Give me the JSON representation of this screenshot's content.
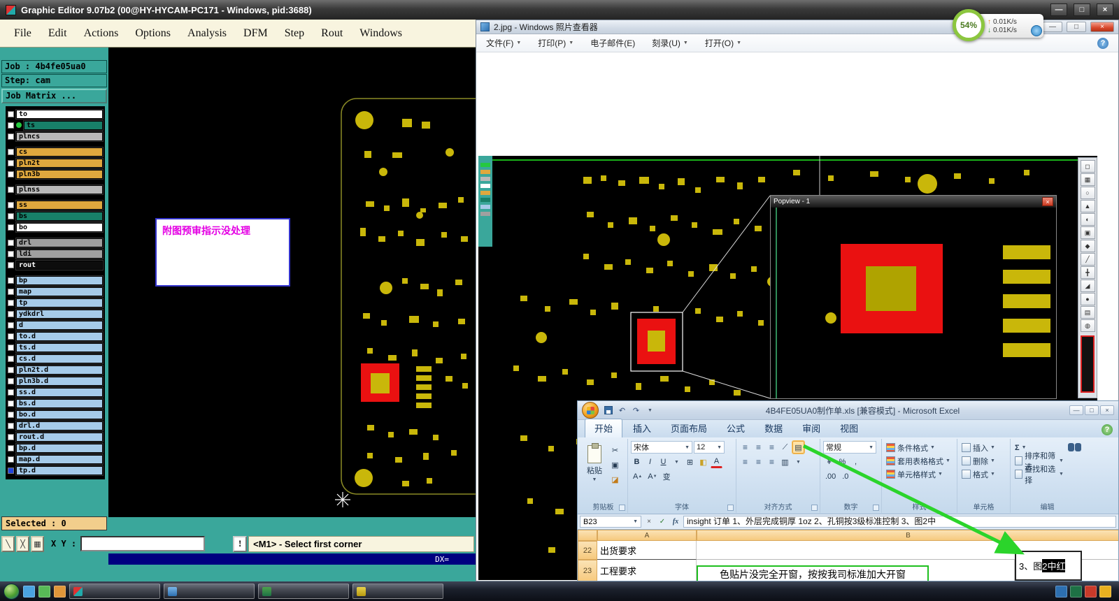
{
  "editor": {
    "title": "Graphic Editor 9.07b2 (00@HY-HYCAM-PC171 - Windows, pid:3688)",
    "window_buttons": {
      "min": "—",
      "max": "□",
      "close": "×"
    },
    "menus": [
      {
        "label": "File"
      },
      {
        "label": "Edit"
      },
      {
        "label": "Actions"
      },
      {
        "label": "Options"
      },
      {
        "label": "Analysis"
      },
      {
        "label": "DFM"
      },
      {
        "label": "Step"
      },
      {
        "label": "Rout"
      },
      {
        "label": "Windows"
      }
    ],
    "job_label": "Job : 4b4fe05ua0",
    "step_label": "Step: cam",
    "job_matrix_label": "Job Matrix ...",
    "layers": [
      {
        "name": "to",
        "type": "white"
      },
      {
        "name": "ts",
        "type": "teal",
        "dot": true
      },
      {
        "name": "plncs",
        "type": "gray"
      },
      {
        "name": "cs",
        "type": "orange",
        "gap": true
      },
      {
        "name": "pln2t",
        "type": "orange"
      },
      {
        "name": "pln3b",
        "type": "orange"
      },
      {
        "name": "plnss",
        "type": "gray",
        "gap": true
      },
      {
        "name": "ss",
        "type": "orange",
        "gap": true
      },
      {
        "name": "bs",
        "type": "teal"
      },
      {
        "name": "bo",
        "type": "white"
      },
      {
        "name": "drl",
        "type": "gray2",
        "gap": true
      },
      {
        "name": "ldi",
        "type": "gray2"
      },
      {
        "name": "rout",
        "type": "black"
      },
      {
        "name": "bp",
        "type": "blue",
        "gap": true
      },
      {
        "name": "map",
        "type": "blue"
      },
      {
        "name": "tp",
        "type": "blue"
      },
      {
        "name": "ydkdrl",
        "type": "blue"
      },
      {
        "name": "d",
        "type": "blue"
      },
      {
        "name": "to.d",
        "type": "blue"
      },
      {
        "name": "ts.d",
        "type": "blue"
      },
      {
        "name": "cs.d",
        "type": "blue"
      },
      {
        "name": "pln2t.d",
        "type": "blue"
      },
      {
        "name": "pln3b.d",
        "type": "blue"
      },
      {
        "name": "ss.d",
        "type": "blue"
      },
      {
        "name": "bs.d",
        "type": "blue"
      },
      {
        "name": "bo.d",
        "type": "blue"
      },
      {
        "name": "drl.d",
        "type": "blue"
      },
      {
        "name": "rout.d",
        "type": "blue"
      },
      {
        "name": "bp.d",
        "type": "blue"
      },
      {
        "name": "map.d",
        "type": "blue"
      },
      {
        "name": "tp.d",
        "type": "blue",
        "active": true
      }
    ],
    "selected_label": "Selected : 0",
    "xy_label": "X Y :",
    "xy_value": "",
    "prompt_icon": "!",
    "prompt": "<M1> - Select first corner",
    "dx_label": "DX=",
    "annotation": "附图预审指示没处理",
    "tool_icons": [
      "╲",
      "╳",
      "▦"
    ]
  },
  "viewer": {
    "title": "2.jpg - Windows 照片查看器",
    "window_buttons": {
      "min": "—",
      "max": "□",
      "close": "×"
    },
    "menus": [
      {
        "label": "文件(F)",
        "arrow": true
      },
      {
        "label": "打印(P)",
        "arrow": true
      },
      {
        "label": "电子邮件(E)"
      },
      {
        "label": "刻录(U)",
        "arrow": true
      },
      {
        "label": "打开(O)",
        "arrow": true
      }
    ],
    "help_icon": "?",
    "popview": {
      "title": "Popview - 1",
      "close": "×"
    },
    "tool_icons": [
      "◻",
      "▦",
      "○",
      "▲",
      "◐",
      "▣",
      "◆",
      "╱",
      "╋",
      "◢",
      "●",
      "▤",
      "◍"
    ]
  },
  "excel": {
    "title": "4B4FE05UA0制作单.xls [兼容模式] - Microsoft Excel",
    "tabs": [
      {
        "label": "开始",
        "active": true
      },
      {
        "label": "插入"
      },
      {
        "label": "页面布局"
      },
      {
        "label": "公式"
      },
      {
        "label": "数据"
      },
      {
        "label": "审阅"
      },
      {
        "label": "视图"
      }
    ],
    "help_icon": "?",
    "clipboard": {
      "label": "剪贴板",
      "paste": "粘贴",
      "cut_icon": "✂"
    },
    "font": {
      "label": "字体",
      "name": "宋体",
      "size": "12",
      "bold": "B",
      "italic": "I",
      "underline": "U",
      "letter": "A"
    },
    "align": {
      "label": "对齐方式",
      "bars": "≡"
    },
    "number": {
      "label": "数字",
      "format": "常规",
      "currency": "¥",
      "percent": "%",
      "comma": ",",
      "add_dec": ".00",
      "del_dec": ".0"
    },
    "styles": {
      "label": "样式",
      "items": [
        {
          "label": "条件格式"
        },
        {
          "label": "套用表格格式"
        },
        {
          "label": "单元格样式"
        }
      ]
    },
    "cells": {
      "label": "单元格",
      "items": [
        {
          "label": "插入"
        },
        {
          "label": "删除"
        },
        {
          "label": "格式"
        }
      ]
    },
    "editing": {
      "label": "编辑",
      "sigma": "Σ",
      "items": [
        {
          "label": "排序和筛选"
        },
        {
          "label": "查找和选择"
        }
      ]
    },
    "name_box": "B23",
    "cancel_icon": "×",
    "enter_icon": "✓",
    "fx_icon": "fx",
    "formula": "insight 订单  1、外层完成铜厚 1oz  2、孔铜按3级标准控制  3、图2中",
    "columns": {
      "a": "A",
      "b": "B"
    },
    "row22": {
      "num": "22",
      "a": "出货要求",
      "b": ""
    },
    "row23": {
      "num": "23",
      "a": "工程要求",
      "b": "insight 订单  1、外层完成铜厚 1oz  2、孔铜按3级标准控制",
      "right_prefix": "3、图",
      "right_highlight": "2中红"
    },
    "tooltip": "色贴片没完全开窗，按按我司标准加大开窗"
  },
  "ball": {
    "percent": "54%",
    "up_icon": "↑",
    "up": "0.01K/s",
    "down_icon": "↓",
    "down": "0.01K/s"
  },
  "icons": {
    "dropdown": "▼",
    "tri_up": "▲",
    "tri_down": "▼"
  },
  "colors": {
    "editor_teal": "#3AA79B",
    "pcb_yellow": "#C9B70A",
    "pcb_red": "#EA1111",
    "arrow_green": "#2BD42B"
  }
}
